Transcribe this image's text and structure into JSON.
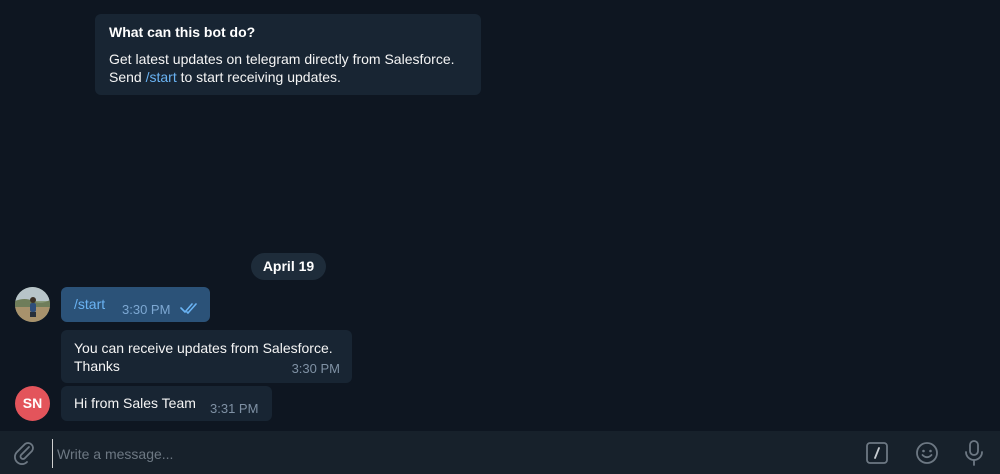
{
  "bot_info": {
    "title": "What can this bot do?",
    "line1": "Get latest updates on telegram directly from Salesforce.",
    "line2_prefix": "Send ",
    "line2_command": "/start",
    "line2_suffix": " to start receiving updates."
  },
  "date_separator": "April 19",
  "messages": [
    {
      "direction": "outgoing",
      "text": "/start",
      "time": "3:30 PM",
      "status": "read"
    },
    {
      "direction": "incoming",
      "line1": "You can receive updates from Salesforce.",
      "line2": "Thanks",
      "time": "3:30 PM"
    },
    {
      "direction": "incoming",
      "text": "Hi from Sales Team",
      "time": "3:31 PM",
      "avatar_initials": "SN"
    }
  ],
  "composer": {
    "placeholder": "Write a message..."
  },
  "icons": {
    "attach": "paperclip-icon",
    "commands": "slash-command-icon",
    "emoji": "smile-icon",
    "voice": "microphone-icon",
    "read_status": "double-check-icon"
  },
  "colors": {
    "background": "#0e1621",
    "incoming_bubble": "#182533",
    "outgoing_bubble": "#2b5278",
    "link": "#6ab3f3",
    "avatar_sn": "#e3545b",
    "composer": "#17212b"
  }
}
